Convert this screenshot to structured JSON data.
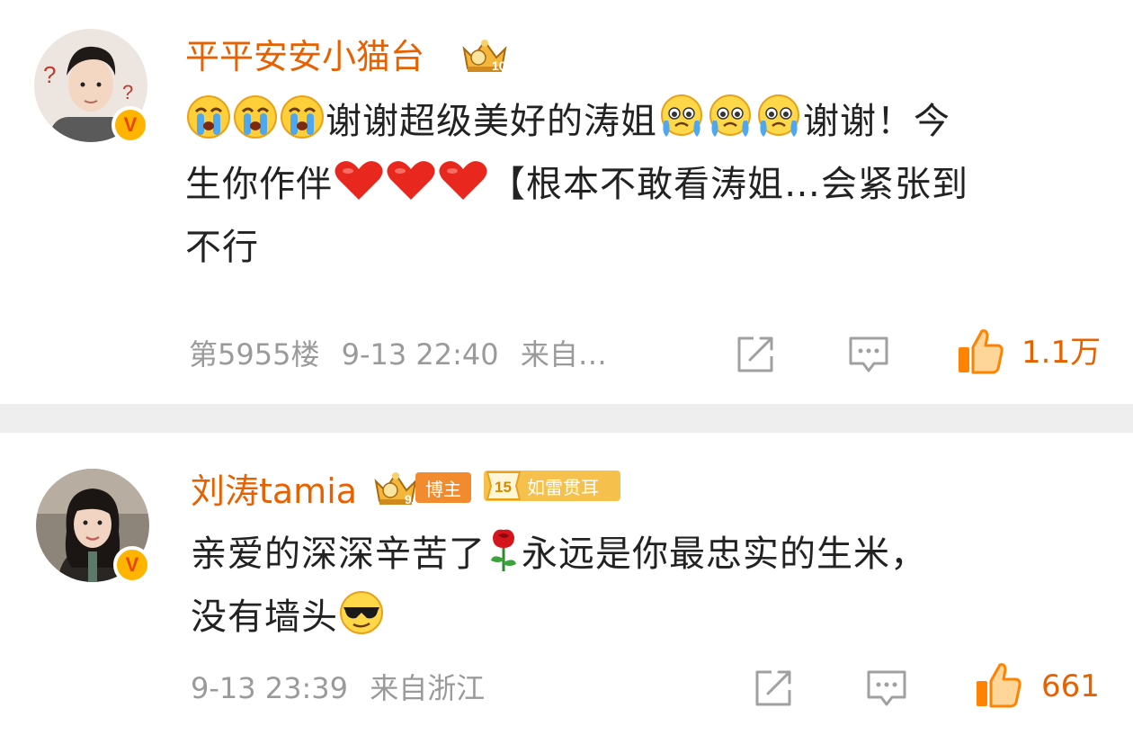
{
  "comments": [
    {
      "username": "平平安安小猫台",
      "level_badge": "10",
      "text_line1_a": "谢谢超级美好的涛姐",
      "text_line1_b": "谢谢！今",
      "text_line2_a": "生你作伴",
      "text_line2_b": "【根本不敢看涛姐…会紧张到",
      "text_line3": "不行",
      "floor": "第5955楼",
      "time": "9-13 22:40",
      "source": "来自…",
      "likes": "1.1万"
    },
    {
      "username": "刘涛tamia",
      "crown_level": "9",
      "tag_blogger": "博主",
      "tag_level_num": "15",
      "tag_level_text": "如雷贯耳",
      "text_line1_a": "亲爱的深深辛苦了",
      "text_line1_b": "永远是你最忠实的生米，",
      "text_line2": "没有墙头",
      "time": "9-13 23:39",
      "source": "来自浙江",
      "likes": "661"
    }
  ],
  "icons": {
    "verified": "V",
    "share": "share-icon",
    "comment": "comment-icon",
    "like": "thumbs-up-icon",
    "cry_emoji": "crying-face-icon",
    "tear_emoji": "tearful-face-icon",
    "heart": "heart-icon",
    "rose": "rose-icon",
    "cool": "sunglasses-face-icon"
  },
  "colors": {
    "username": "#e86100",
    "text": "#222222",
    "meta": "#9a9a9a",
    "like_orange": "#ff8200",
    "separator": "#eeeeee"
  }
}
